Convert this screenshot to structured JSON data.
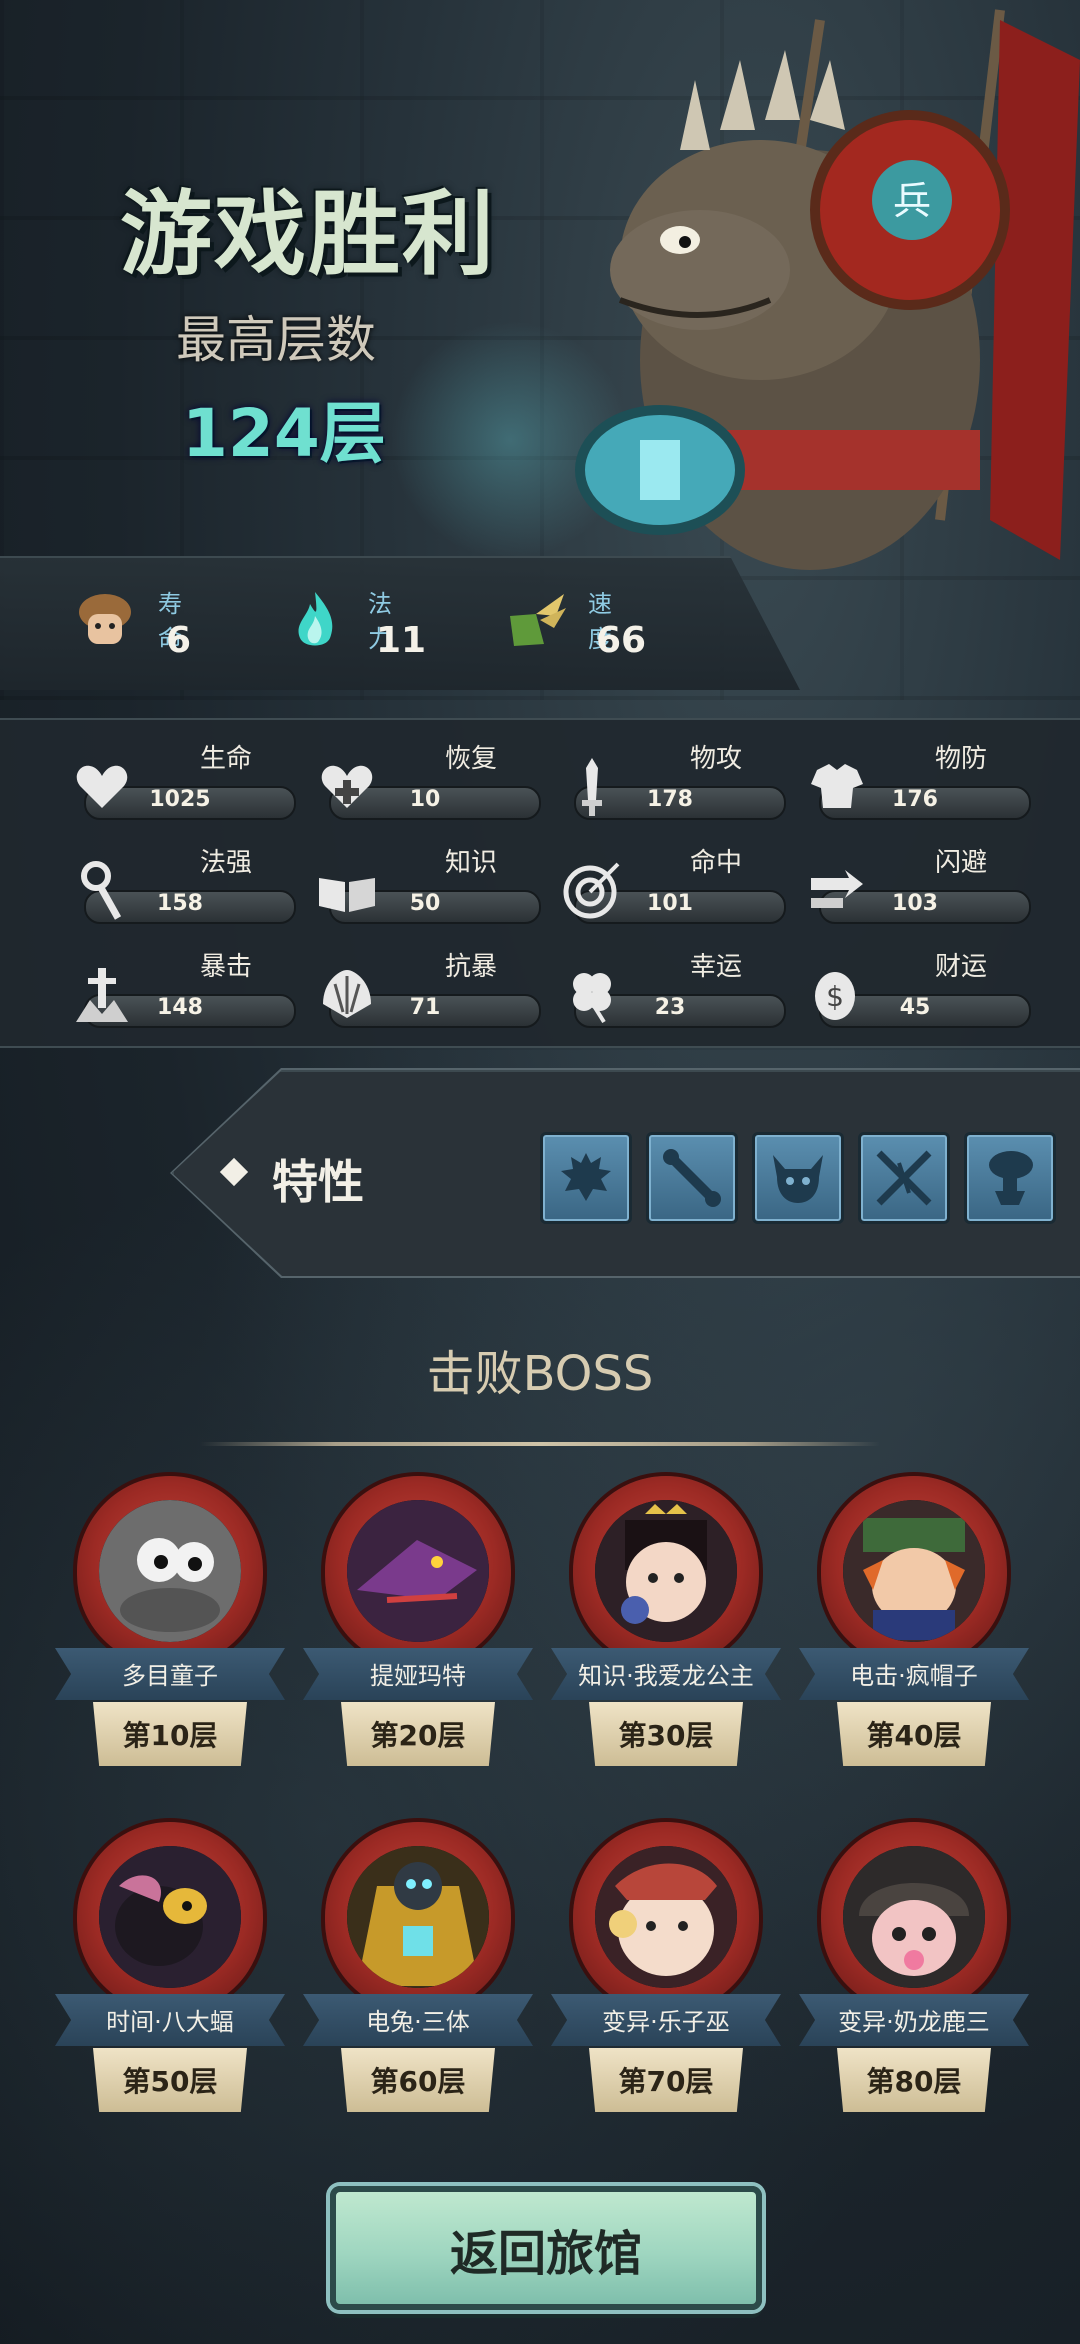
{
  "result": {
    "title": "游戏胜利",
    "best_floor_label": "最高层数",
    "best_floor_value": "124层"
  },
  "top_stats": [
    {
      "label": "寿命",
      "value": "6",
      "icon": "mushroom-creature-icon"
    },
    {
      "label": "法力",
      "value": "11",
      "icon": "blue-flame-icon"
    },
    {
      "label": "速度",
      "value": "66",
      "icon": "winged-boot-icon"
    }
  ],
  "attributes": [
    {
      "label": "生命",
      "value": "1025",
      "icon": "heart-icon"
    },
    {
      "label": "恢复",
      "value": "10",
      "icon": "heal-heart-icon"
    },
    {
      "label": "物攻",
      "value": "178",
      "icon": "sword-icon"
    },
    {
      "label": "物防",
      "value": "176",
      "icon": "armor-icon"
    },
    {
      "label": "法强",
      "value": "158",
      "icon": "staff-icon"
    },
    {
      "label": "知识",
      "value": "50",
      "icon": "book-icon"
    },
    {
      "label": "命中",
      "value": "101",
      "icon": "target-icon"
    },
    {
      "label": "闪避",
      "value": "103",
      "icon": "dash-arrows-icon"
    },
    {
      "label": "暴击",
      "value": "148",
      "icon": "critical-strike-icon"
    },
    {
      "label": "抗暴",
      "value": "71",
      "icon": "shield-shell-icon"
    },
    {
      "label": "幸运",
      "value": "23",
      "icon": "clover-icon"
    },
    {
      "label": "财运",
      "value": "45",
      "icon": "coin-icon"
    }
  ],
  "traits": {
    "label": "特性",
    "slots": [
      "spiky-creature-icon",
      "spine-bone-icon",
      "horned-demon-icon",
      "crossed-blades-icon",
      "mushroom-figure-icon"
    ]
  },
  "defeated": {
    "title": "击败BOSS",
    "bosses": [
      {
        "name": "多目童子",
        "floor": "第10层"
      },
      {
        "name": "提娅玛特",
        "floor": "第20层"
      },
      {
        "name": "知识·我爱龙公主",
        "floor": "第30层"
      },
      {
        "name": "电击·疯帽子",
        "floor": "第40层"
      },
      {
        "name": "时间·八大蝠",
        "floor": "第50层"
      },
      {
        "name": "电兔·三体",
        "floor": "第60层"
      },
      {
        "name": "变异·乐子巫",
        "floor": "第70层"
      },
      {
        "name": "变异·奶龙鹿三",
        "floor": "第80层"
      }
    ]
  },
  "return_button": "返回旅馆",
  "colors": {
    "accent_cyan": "#6fe0d0",
    "boss_frame_red": "#9c2a24",
    "button_green": "#9fd6c0"
  }
}
